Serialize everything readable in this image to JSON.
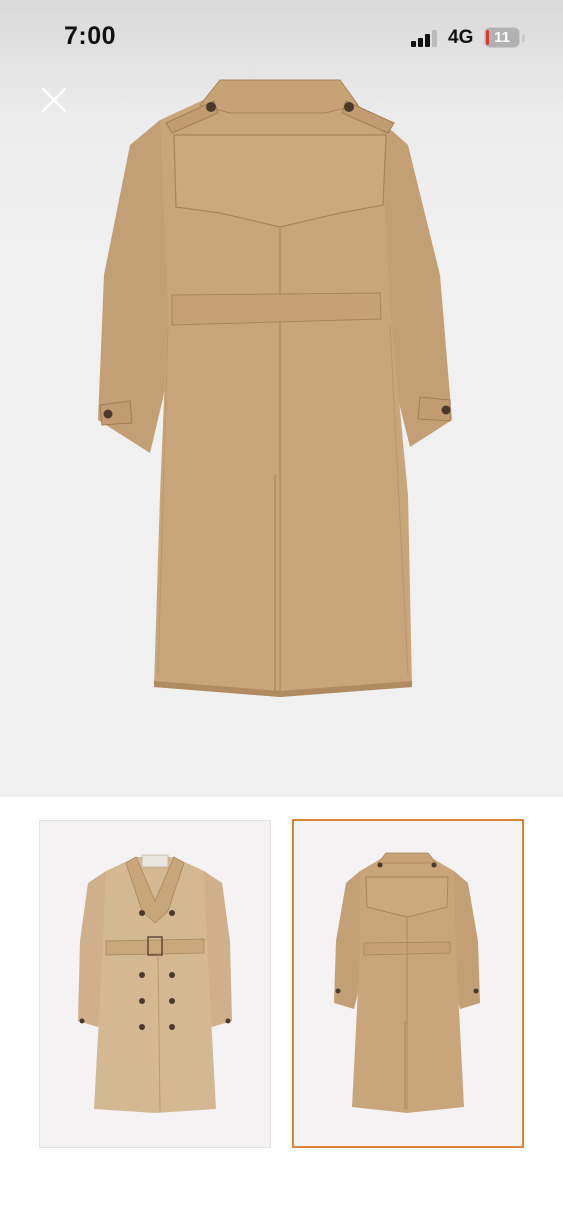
{
  "status_bar": {
    "time": "7:00",
    "network": "4G",
    "battery": "11",
    "battery_low_color": "#e0352b"
  },
  "viewer": {
    "close_icon": "close-icon",
    "main_image": "trench-coat-back-view"
  },
  "thumbnails": [
    {
      "image": "trench-coat-front-view",
      "selected": false
    },
    {
      "image": "trench-coat-back-view",
      "selected": true,
      "border_color": "#d98435"
    }
  ],
  "colors": {
    "coat": "#c9a57c",
    "coat_shadow": "#b08a60",
    "background": "#f1f0f0"
  }
}
